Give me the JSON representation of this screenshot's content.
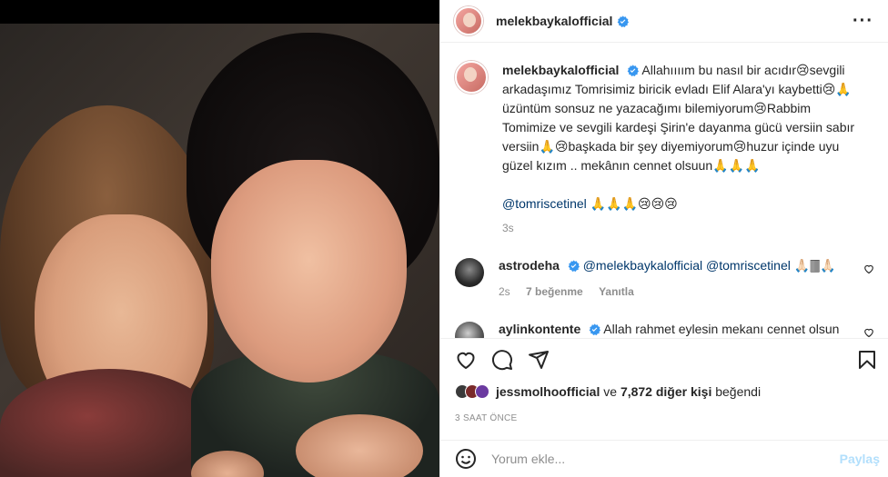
{
  "post": {
    "username": "melekbaykalofficial",
    "verified": true
  },
  "caption": {
    "username": "melekbaykalofficial",
    "text": "Allahıııım bu nasıl bir acıdır😢sevgili arkadaşımız Tomrisimiz biricik evladı Elif Alara'yı kaybetti😢🙏 üzüntüm sonsuz ne yazacağımı bilemiyorum😢Rabbim Tomimize ve sevgili kardeşi Şirin'e dayanma gücü versiin sabır versiin🙏😢başkada bir şey diyemiyorum😢huzur içinde uyu güzel kızım .. mekânın cennet olsuun🙏🙏🙏",
    "mention": "@tomriscetinel",
    "mention_emojis": "🙏🙏🙏😢😢😢",
    "time": "3s"
  },
  "comments": [
    {
      "username": "astrodeha",
      "verified": true,
      "mentions": "@melekbaykalofficial @tomriscetinel",
      "emojis": "🙏🏻🀫🙏🏻",
      "time": "2s",
      "likes": "7 beğenme",
      "reply": "Yanıtla"
    },
    {
      "username": "aylinkontente",
      "verified": true,
      "text": "Allah rahmet eylesin mekanı cennet olsun allah sabır versin🙏🏻🙏🏻🙏🏻"
    }
  ],
  "likes": {
    "first_user": "jessmolhoofficial",
    "connector": "ve",
    "others": "7,872 diğer kişi",
    "suffix": "beğendi"
  },
  "timestamp": "3 SAAT ÖNCE",
  "add_comment": {
    "placeholder": "Yorum ekle...",
    "post_label": "Paylaş"
  },
  "colors": {
    "verified_blue": "#3897f0",
    "mention": "#00376b",
    "post_button_disabled": "#b2dffc",
    "secondary_text": "#8e8e8e"
  },
  "icons": [
    "more-icon",
    "heart-icon",
    "comment-icon",
    "share-icon",
    "bookmark-icon",
    "emoji-icon",
    "verified-icon"
  ]
}
